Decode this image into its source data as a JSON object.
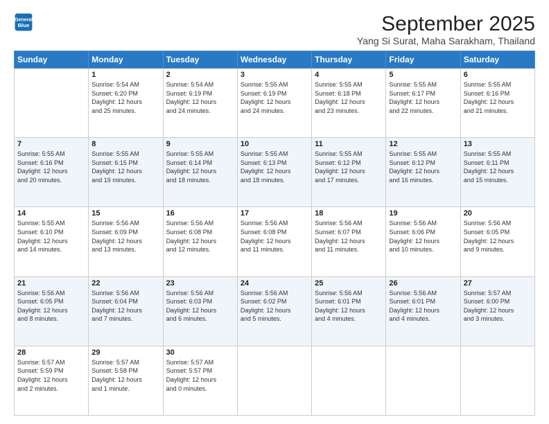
{
  "header": {
    "logo_line1": "General",
    "logo_line2": "Blue",
    "month": "September 2025",
    "location": "Yang Si Surat, Maha Sarakham, Thailand"
  },
  "weekdays": [
    "Sunday",
    "Monday",
    "Tuesday",
    "Wednesday",
    "Thursday",
    "Friday",
    "Saturday"
  ],
  "weeks": [
    [
      {
        "day": "",
        "info": ""
      },
      {
        "day": "1",
        "info": "Sunrise: 5:54 AM\nSunset: 6:20 PM\nDaylight: 12 hours\nand 25 minutes."
      },
      {
        "day": "2",
        "info": "Sunrise: 5:54 AM\nSunset: 6:19 PM\nDaylight: 12 hours\nand 24 minutes."
      },
      {
        "day": "3",
        "info": "Sunrise: 5:55 AM\nSunset: 6:19 PM\nDaylight: 12 hours\nand 24 minutes."
      },
      {
        "day": "4",
        "info": "Sunrise: 5:55 AM\nSunset: 6:18 PM\nDaylight: 12 hours\nand 23 minutes."
      },
      {
        "day": "5",
        "info": "Sunrise: 5:55 AM\nSunset: 6:17 PM\nDaylight: 12 hours\nand 22 minutes."
      },
      {
        "day": "6",
        "info": "Sunrise: 5:55 AM\nSunset: 6:16 PM\nDaylight: 12 hours\nand 21 minutes."
      }
    ],
    [
      {
        "day": "7",
        "info": "Sunrise: 5:55 AM\nSunset: 6:16 PM\nDaylight: 12 hours\nand 20 minutes."
      },
      {
        "day": "8",
        "info": "Sunrise: 5:55 AM\nSunset: 6:15 PM\nDaylight: 12 hours\nand 19 minutes."
      },
      {
        "day": "9",
        "info": "Sunrise: 5:55 AM\nSunset: 6:14 PM\nDaylight: 12 hours\nand 18 minutes."
      },
      {
        "day": "10",
        "info": "Sunrise: 5:55 AM\nSunset: 6:13 PM\nDaylight: 12 hours\nand 18 minutes."
      },
      {
        "day": "11",
        "info": "Sunrise: 5:55 AM\nSunset: 6:12 PM\nDaylight: 12 hours\nand 17 minutes."
      },
      {
        "day": "12",
        "info": "Sunrise: 5:55 AM\nSunset: 6:12 PM\nDaylight: 12 hours\nand 16 minutes."
      },
      {
        "day": "13",
        "info": "Sunrise: 5:55 AM\nSunset: 6:11 PM\nDaylight: 12 hours\nand 15 minutes."
      }
    ],
    [
      {
        "day": "14",
        "info": "Sunrise: 5:55 AM\nSunset: 6:10 PM\nDaylight: 12 hours\nand 14 minutes."
      },
      {
        "day": "15",
        "info": "Sunrise: 5:56 AM\nSunset: 6:09 PM\nDaylight: 12 hours\nand 13 minutes."
      },
      {
        "day": "16",
        "info": "Sunrise: 5:56 AM\nSunset: 6:08 PM\nDaylight: 12 hours\nand 12 minutes."
      },
      {
        "day": "17",
        "info": "Sunrise: 5:56 AM\nSunset: 6:08 PM\nDaylight: 12 hours\nand 11 minutes."
      },
      {
        "day": "18",
        "info": "Sunrise: 5:56 AM\nSunset: 6:07 PM\nDaylight: 12 hours\nand 11 minutes."
      },
      {
        "day": "19",
        "info": "Sunrise: 5:56 AM\nSunset: 6:06 PM\nDaylight: 12 hours\nand 10 minutes."
      },
      {
        "day": "20",
        "info": "Sunrise: 5:56 AM\nSunset: 6:05 PM\nDaylight: 12 hours\nand 9 minutes."
      }
    ],
    [
      {
        "day": "21",
        "info": "Sunrise: 5:56 AM\nSunset: 6:05 PM\nDaylight: 12 hours\nand 8 minutes."
      },
      {
        "day": "22",
        "info": "Sunrise: 5:56 AM\nSunset: 6:04 PM\nDaylight: 12 hours\nand 7 minutes."
      },
      {
        "day": "23",
        "info": "Sunrise: 5:56 AM\nSunset: 6:03 PM\nDaylight: 12 hours\nand 6 minutes."
      },
      {
        "day": "24",
        "info": "Sunrise: 5:56 AM\nSunset: 6:02 PM\nDaylight: 12 hours\nand 5 minutes."
      },
      {
        "day": "25",
        "info": "Sunrise: 5:56 AM\nSunset: 6:01 PM\nDaylight: 12 hours\nand 4 minutes."
      },
      {
        "day": "26",
        "info": "Sunrise: 5:56 AM\nSunset: 6:01 PM\nDaylight: 12 hours\nand 4 minutes."
      },
      {
        "day": "27",
        "info": "Sunrise: 5:57 AM\nSunset: 6:00 PM\nDaylight: 12 hours\nand 3 minutes."
      }
    ],
    [
      {
        "day": "28",
        "info": "Sunrise: 5:57 AM\nSunset: 5:59 PM\nDaylight: 12 hours\nand 2 minutes."
      },
      {
        "day": "29",
        "info": "Sunrise: 5:57 AM\nSunset: 5:58 PM\nDaylight: 12 hours\nand 1 minute."
      },
      {
        "day": "30",
        "info": "Sunrise: 5:57 AM\nSunset: 5:57 PM\nDaylight: 12 hours\nand 0 minutes."
      },
      {
        "day": "",
        "info": ""
      },
      {
        "day": "",
        "info": ""
      },
      {
        "day": "",
        "info": ""
      },
      {
        "day": "",
        "info": ""
      }
    ]
  ]
}
